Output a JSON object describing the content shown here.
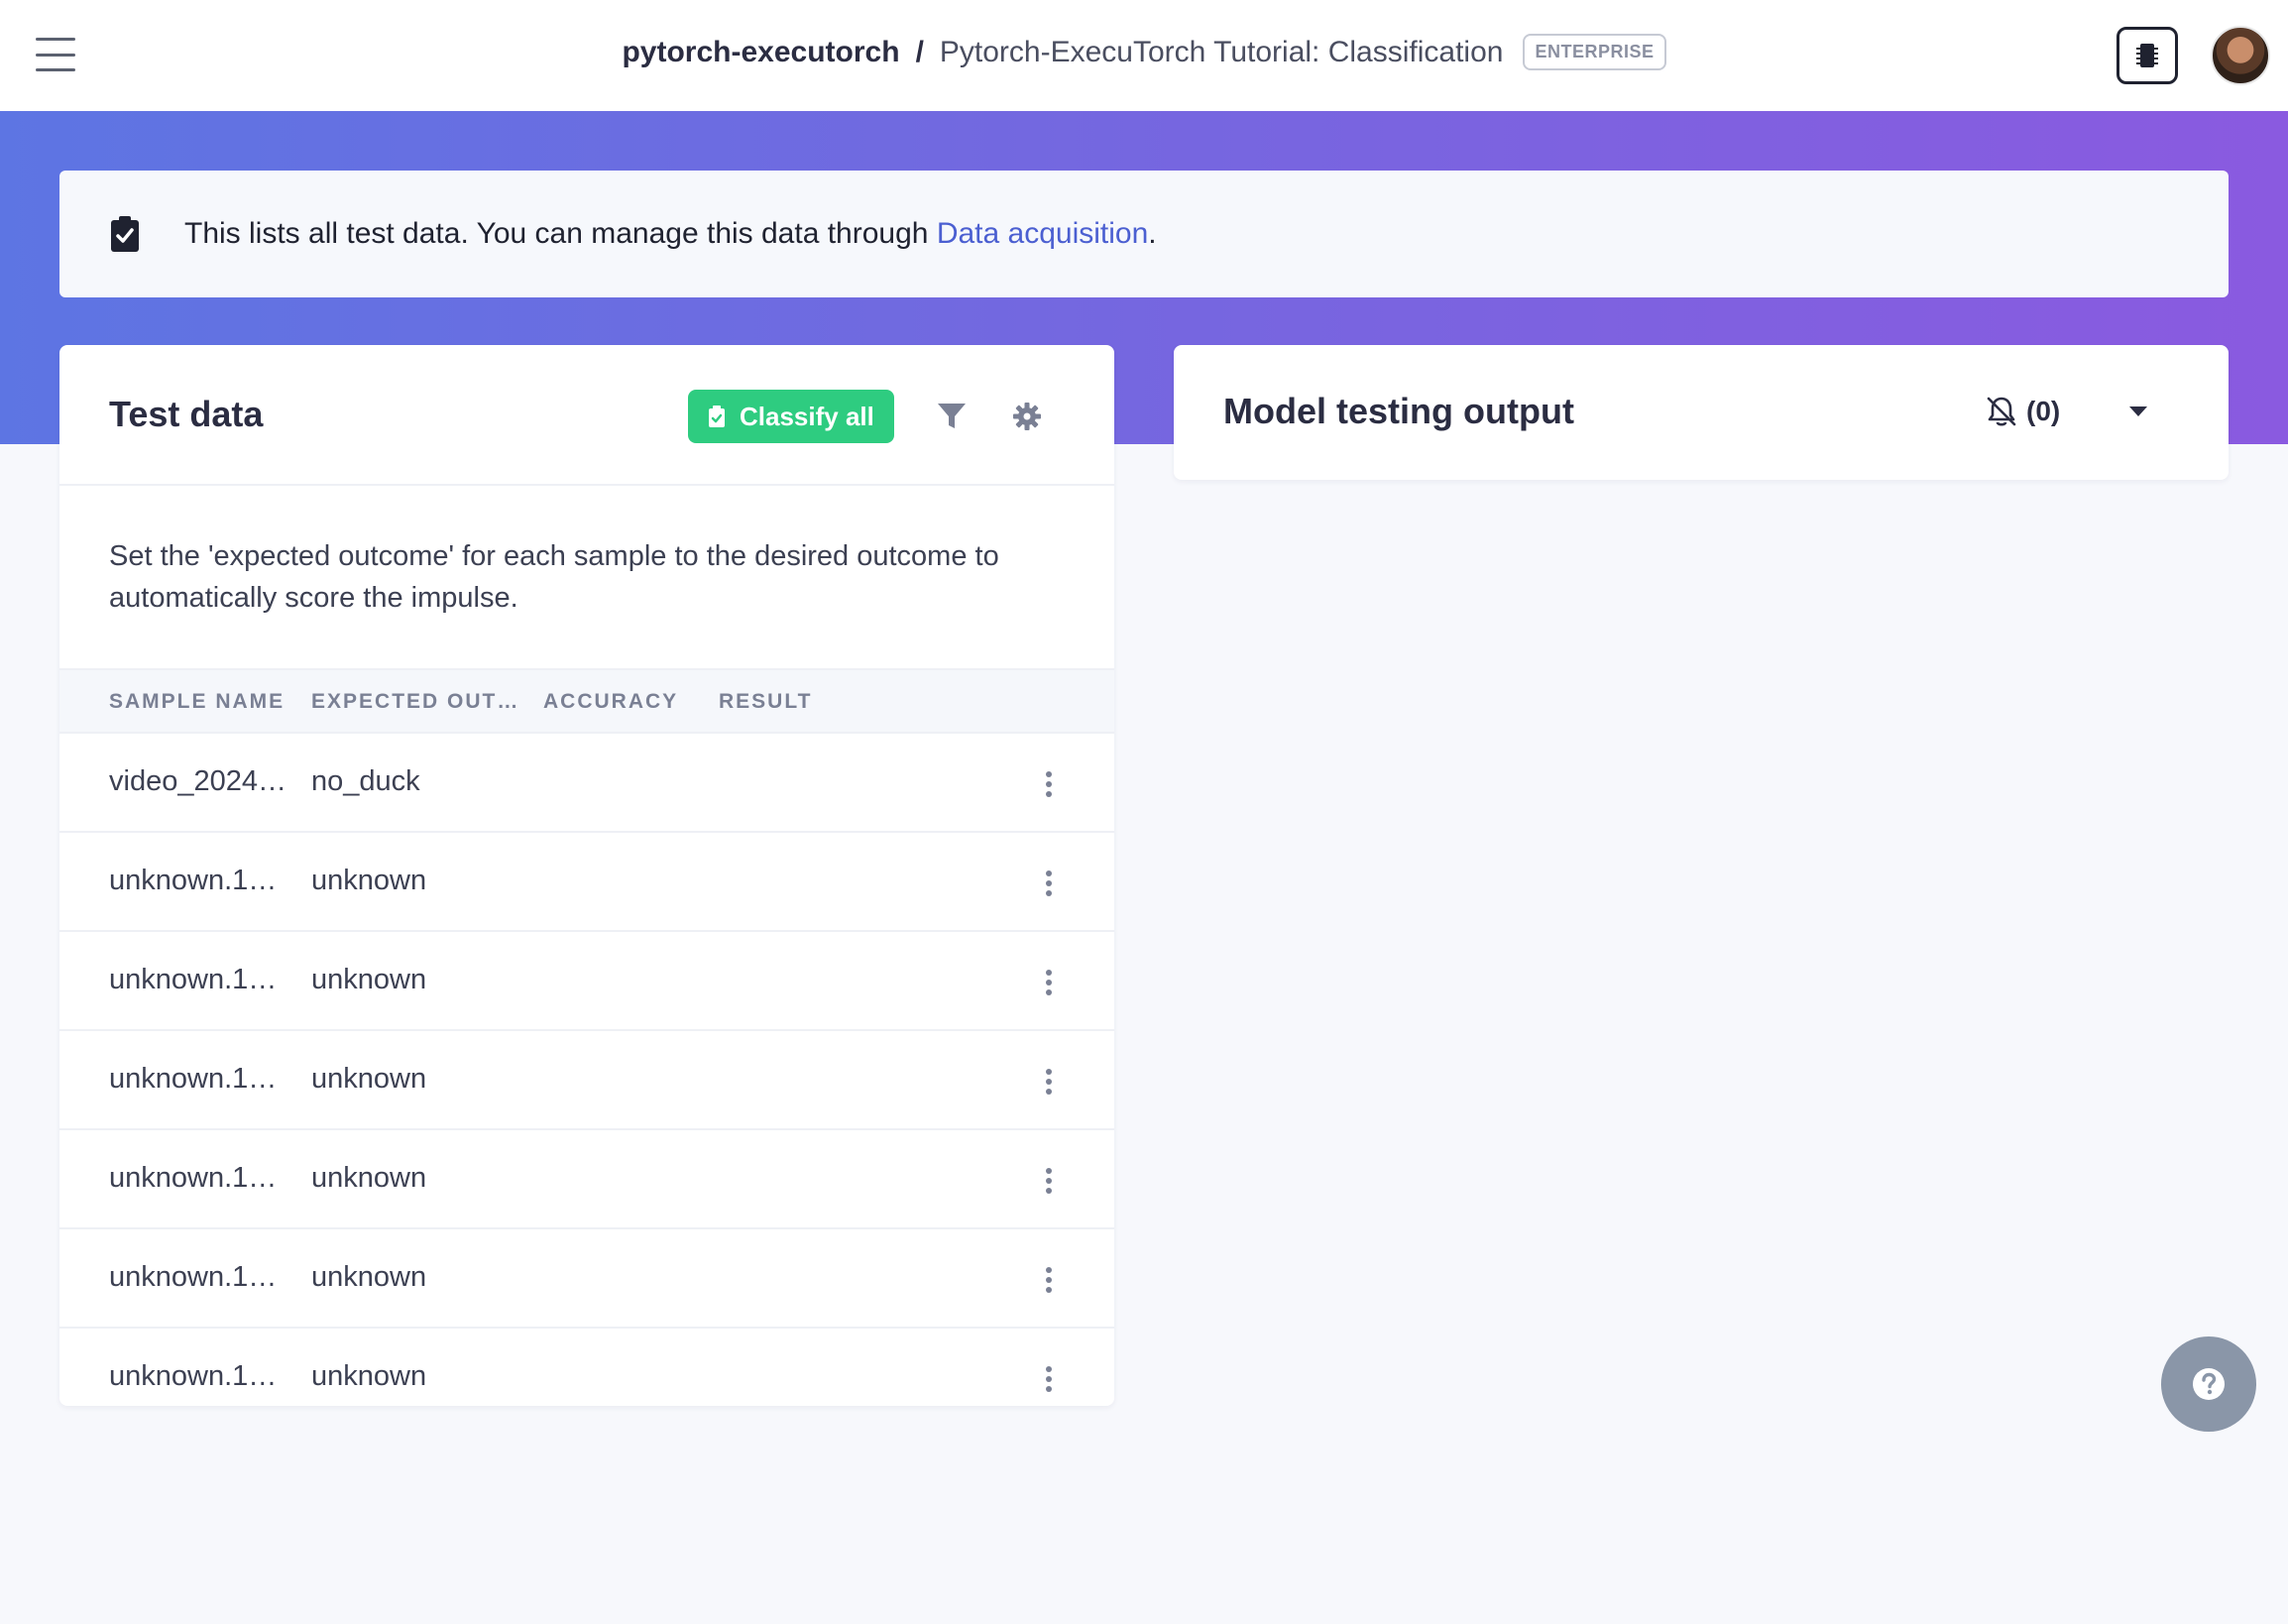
{
  "header": {
    "project": "pytorch-executorch",
    "separator": "/",
    "title": "Pytorch-ExecuTorch Tutorial: Classification",
    "badge": "ENTERPRISE"
  },
  "info": {
    "text": "This lists all test data. You can manage this data through ",
    "link": "Data acquisition",
    "suffix": "."
  },
  "test_data": {
    "title": "Test data",
    "classify_label": "Classify all",
    "description": "Set the 'expected outcome' for each sample to the desired outcome to automatically score the impulse.",
    "columns": [
      "SAMPLE NAME",
      "EXPECTED OUT…",
      "ACCURACY",
      "RESULT"
    ],
    "rows": [
      {
        "name": "video_2024…",
        "expected": "no_duck"
      },
      {
        "name": "unknown.1…",
        "expected": "unknown"
      },
      {
        "name": "unknown.1…",
        "expected": "unknown"
      },
      {
        "name": "unknown.1…",
        "expected": "unknown"
      },
      {
        "name": "unknown.1…",
        "expected": "unknown"
      },
      {
        "name": "unknown.1…",
        "expected": "unknown"
      },
      {
        "name": "unknown.1…",
        "expected": "unknown"
      }
    ]
  },
  "model_output": {
    "title": "Model testing output",
    "notifications": "(0)"
  },
  "colors": {
    "accent_green": "#2ecc80",
    "link_blue": "#4b5fd1",
    "gradient_start": "#5d75e3",
    "gradient_end": "#8a5ae0"
  },
  "icons": [
    "menu-icon",
    "chip-icon",
    "clipboard-check-icon",
    "filter-icon",
    "gear-icon",
    "bell-slash-icon",
    "chevron-down-icon",
    "more-vertical-icon",
    "help-icon"
  ]
}
